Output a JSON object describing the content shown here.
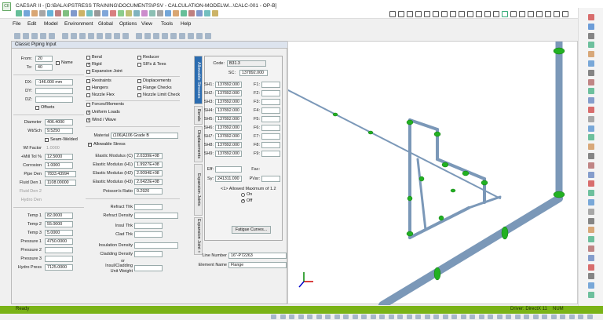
{
  "window": {
    "title": "CAESAR II - [D:\\BALA\\PSTRESS TRAINING\\DOCUMENTS\\PSV - CALCULATION-MODEL\\M...\\CALC-001 - OP-B]",
    "icon_text": "CII"
  },
  "menu": [
    "File",
    "Edit",
    "Model",
    "Environment",
    "Global",
    "Options",
    "View",
    "Tools",
    "Help"
  ],
  "panel": {
    "title": "Classic Piping Input",
    "from_label": "From:",
    "from": "20",
    "to_label": "To:",
    "to": "40",
    "name_label": "Name",
    "dx_label": "DX:",
    "dx": "-146.000 mm",
    "dy_label": "DY:",
    "dy": "",
    "dz_label": "DZ:",
    "dz": "",
    "offsets_label": "Offsets",
    "diameter_label": "Diameter",
    "diameter": "406.4000",
    "wt_label": "Wt/Sch",
    "wt": "9.5250",
    "seam_label": "Seam-Welded",
    "wtfactor_label": "Wl Factor",
    "wtfactor": "1.0000",
    "milltol_label": "+Mill Tol %",
    "milltol": "12.5000",
    "corrosion_label": "Corrosion",
    "corrosion": "1.0000",
    "pipeden_label": "Pipe Den",
    "pipeden": "7833.43994",
    "fluidden1_label": "Fluid Den 1",
    "fluidden1": "1108.00000",
    "fluidden2_label": "Fluid Den 2",
    "fluidden2": "",
    "hydroden_label": "Hydro Den",
    "hydroden": "",
    "temp1_label": "Temp 1",
    "temp1": "82.0000",
    "temp2_label": "Temp 2",
    "temp2": "55.0000",
    "temp3_label": "Temp 3",
    "temp3": "5.0000",
    "press1_label": "Pressure 1",
    "press1": "4750.0000",
    "press2_label": "Pressure 2",
    "press2": "",
    "press3_label": "Pressure 3",
    "press3": "",
    "hydro_label": "Hydro Press",
    "hydro": "7125.0000",
    "checks": [
      {
        "label": "Bend",
        "on": false
      },
      {
        "label": "Reducer",
        "on": false
      },
      {
        "label": "Rigid",
        "on": true
      },
      {
        "label": "SIFs & Tees",
        "on": false
      },
      {
        "label": "Expansion Joint",
        "on": false
      },
      {
        "label": "Restraints",
        "on": false
      },
      {
        "label": "Displacements",
        "on": false
      },
      {
        "label": "Hangers",
        "on": false
      },
      {
        "label": "Flange Checks",
        "on": false
      },
      {
        "label": "Nozzle Flex",
        "on": false
      },
      {
        "label": "Nozzle Limit Check",
        "on": false
      },
      {
        "label": "Forces/Moments",
        "on": false
      },
      {
        "label": "Uniform Loads",
        "on": true
      },
      {
        "label": "Wind / Wave",
        "on": true
      }
    ],
    "material_label": "Material",
    "material": "(106)A106 Grade B",
    "allowable_label": "Allowable Stress",
    "ec_label": "Elastic Modulus (C)",
    "ec": "2.0339E+08",
    "eh1_label": "Elastic Modulus (H1)",
    "eh1": "1.9927E+08",
    "eh2_label": "Elastic Modulus (H2)",
    "eh2": "2.0094E+08",
    "eh3_label": "Elastic Modulus (H3)",
    "eh3": "2.0422E+08",
    "poisson_label": "Poisson's Ratio",
    "poisson": "0.2920",
    "refthk_label": "Refract Thk",
    "refthk": "",
    "refden_label": "Refract Density",
    "refden": "",
    "insthk_label": "Insul Thk",
    "insthk": "",
    "cladthk_label": "Clad Thk",
    "cladthk": "",
    "insden_label": "Insulation Density",
    "insden": "",
    "cladden_label": "Cladding Density",
    "cladden": "",
    "or_label": "or",
    "unitw_label1": "Insul/Cladding",
    "unitw_label2": "Unit Weight",
    "unitw": "",
    "tabs": [
      "Allowable Stresses",
      "Bends",
      "Displacements",
      "Expansion Joints",
      "Expansion Joint +"
    ],
    "code_label": "Code:",
    "code": "B31.3",
    "sc_label": "SC:",
    "sc": "137892.000",
    "sh_rows": [
      {
        "sh": "SH1:",
        "v": "137892.000",
        "f": "F1:"
      },
      {
        "sh": "SH2:",
        "v": "137892.000",
        "f": "F2:"
      },
      {
        "sh": "SH3:",
        "v": "137892.000",
        "f": "F3:"
      },
      {
        "sh": "SH4:",
        "v": "137892.000",
        "f": "F4:"
      },
      {
        "sh": "SH5:",
        "v": "137892.000",
        "f": "F5:"
      },
      {
        "sh": "SH6:",
        "v": "137892.000",
        "f": "F6:"
      },
      {
        "sh": "SH7:",
        "v": "137892.000",
        "f": "F7:"
      },
      {
        "sh": "SH8:",
        "v": "137892.000",
        "f": "F8:"
      },
      {
        "sh": "SH9:",
        "v": "137892.000",
        "f": "F9:"
      }
    ],
    "eff_label": "Eff:",
    "fac_label": "Fac:",
    "sy_label": "Sy:",
    "sy": "241311.000",
    "pvar_label": "PVar:",
    "allowed_max": "<1> Allowed Maximum of 1.2",
    "on_label": "On",
    "off_label": "Off",
    "fatigue_btn": "Fatigue Curves...",
    "line_no_label": "Line Number",
    "line_no": "16\"-P72263",
    "elem_name_label": "Element Name",
    "elem_name": "Flange"
  },
  "status": {
    "left": "Ready",
    "driver": "Driver: DirectX 11",
    "num": "NUM"
  },
  "colors": {
    "status_bg": "#7ab317",
    "pipe": "#8aa8c8",
    "flange": "#22b122",
    "accent": "#2b6cb0"
  }
}
